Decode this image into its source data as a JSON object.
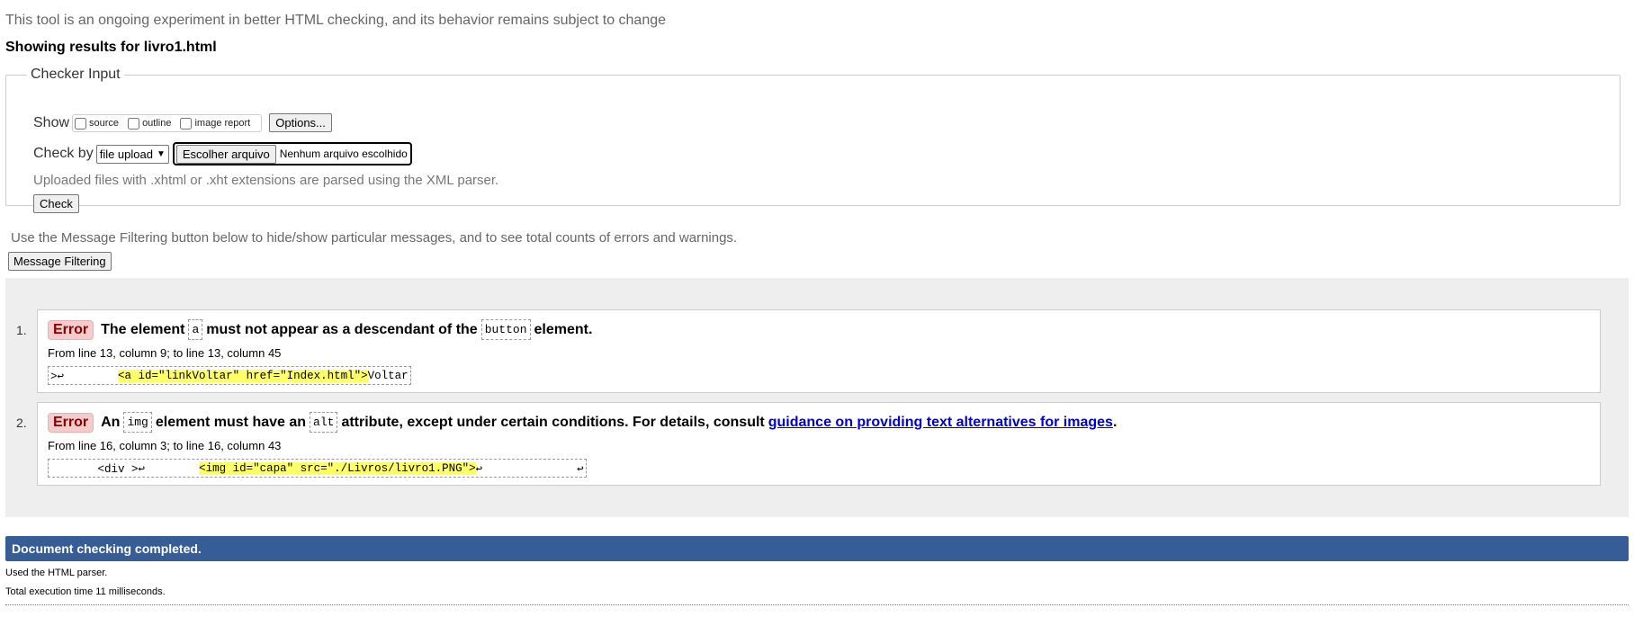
{
  "notice": "This tool is an ongoing experiment in better HTML checking, and its behavior remains subject to change",
  "showing": "Showing results for livro1.html",
  "checker": {
    "legend": "Checker Input",
    "show_label": "Show",
    "options": [
      {
        "label": "source",
        "checked": false
      },
      {
        "label": "outline",
        "checked": false
      },
      {
        "label": "image report",
        "checked": false
      }
    ],
    "options_button": "Options...",
    "check_by_label": "Check by",
    "check_by_value": "file upload",
    "file_button": "Escolher arquivo",
    "file_status": "Nenhum arquivo escolhido",
    "uploaded_note": "Uploaded files with .xhtml or .xht extensions are parsed using the XML parser.",
    "check_button": "Check"
  },
  "filter_note": "Use the Message Filtering button below to hide/show particular messages, and to see total counts of errors and warnings.",
  "filter_button": "Message Filtering",
  "messages": [
    {
      "num": "1.",
      "type": "Error",
      "text_1": "The element",
      "code_1": "a",
      "text_2": "must not appear as a descendant of the",
      "code_2": "button",
      "text_3": "element.",
      "location": "From line 13, column 9; to line 13, column 45",
      "extract_pre": ">↩        ",
      "extract_hl": "<a id=\"linkVoltar\" href=\"Index.html\">",
      "extract_post": "Voltar"
    },
    {
      "num": "2.",
      "type": "Error",
      "text_1": "An",
      "code_1": "img",
      "text_2": "element must have an",
      "code_2": "alt",
      "text_3": "attribute, except under certain conditions. For details, consult",
      "link": "guidance on providing text alternatives for images",
      "text_4": ".",
      "location": "From line 16, column 3; to line 16, column 43",
      "extract_pre": "       <div >↩        ",
      "extract_hl": "<img id=\"capa\" src=\"./Livros/livro1.PNG\">",
      "extract_post": "↩              ↩"
    }
  ],
  "completed": "Document checking completed.",
  "used_parser": "Used the HTML parser.",
  "exec_time": "Total execution time 11 milliseconds."
}
